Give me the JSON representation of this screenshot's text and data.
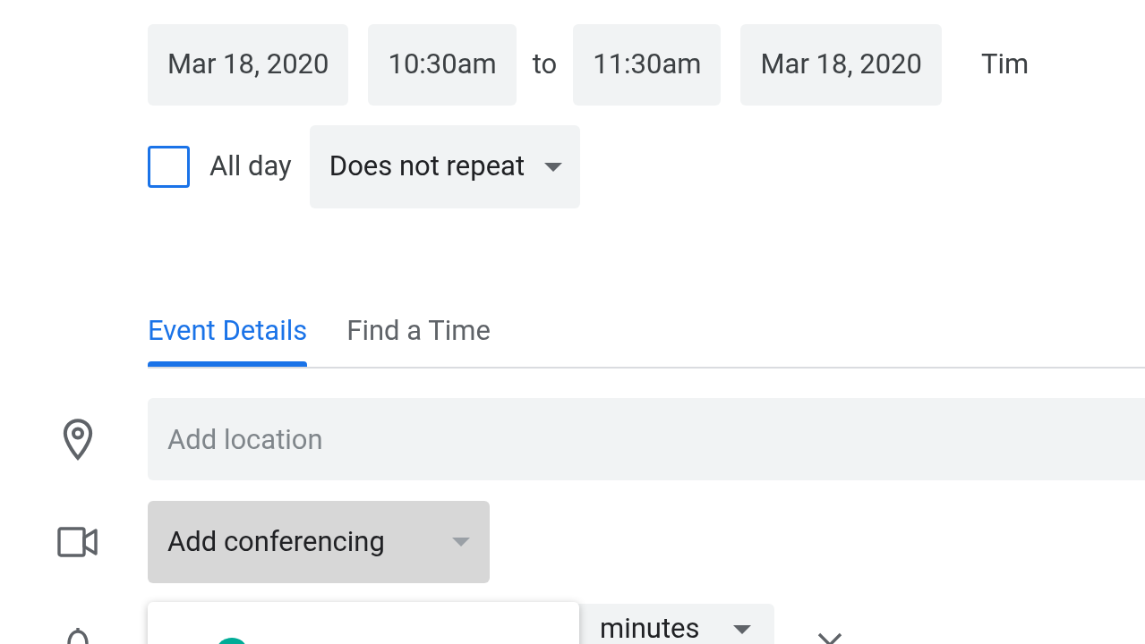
{
  "date_row": {
    "start_date": "Mar 18, 2020",
    "start_time": "10:30am",
    "separator": "to",
    "end_time": "11:30am",
    "end_date": "Mar 18, 2020",
    "timezone": "Tim"
  },
  "all_day": {
    "label": "All day",
    "checked": false
  },
  "repeat": {
    "value": "Does not repeat"
  },
  "tabs": [
    {
      "label": "Event Details",
      "selected": true
    },
    {
      "label": "Find a Time",
      "selected": false
    }
  ],
  "location": {
    "placeholder": "Add location"
  },
  "conferencing": {
    "label": "Add conferencing"
  },
  "notification": {
    "unit": "minutes"
  }
}
